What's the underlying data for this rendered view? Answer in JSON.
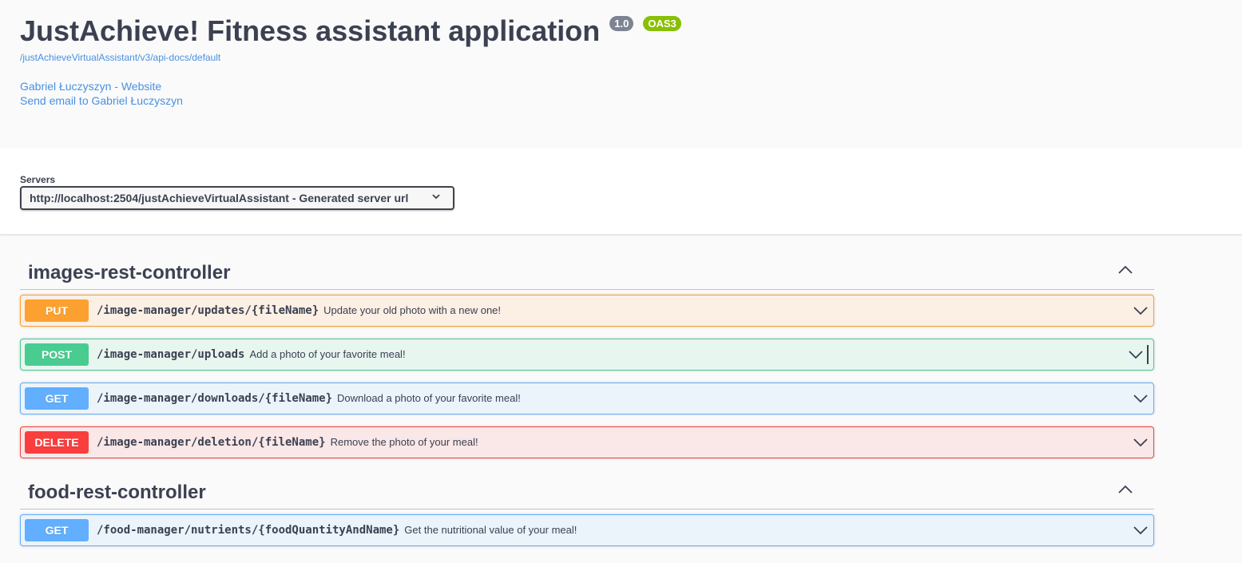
{
  "info": {
    "title": "JustAchieve! Fitness assistant application",
    "version": "1.0",
    "oas": "OAS3",
    "doc_url": "/justAchieveVirtualAssistant/v3/api-docs/default",
    "contact_website": "Gabriel Łuczyszyn - Website",
    "contact_email": "Send email to Gabriel Łuczyszyn"
  },
  "servers": {
    "label": "Servers",
    "selected": "http://localhost:2504/justAchieveVirtualAssistant - Generated server url"
  },
  "tags": [
    {
      "name": "images-rest-controller",
      "operations": [
        {
          "method": "PUT",
          "path": "/image-manager/updates/{fileName}",
          "summary": "Update your old photo with a new one!"
        },
        {
          "method": "POST",
          "path": "/image-manager/uploads",
          "summary": "Add a photo of your favorite meal!"
        },
        {
          "method": "GET",
          "path": "/image-manager/downloads/{fileName}",
          "summary": "Download a photo of your favorite meal!"
        },
        {
          "method": "DELETE",
          "path": "/image-manager/deletion/{fileName}",
          "summary": "Remove the photo of your meal!"
        }
      ]
    },
    {
      "name": "food-rest-controller",
      "operations": [
        {
          "method": "GET",
          "path": "/food-manager/nutrients/{foodQuantityAndName}",
          "summary": "Get the nutritional value of your meal!"
        }
      ]
    }
  ],
  "colors": {
    "put": "#fca130",
    "post": "#49cc90",
    "get": "#61affe",
    "delete": "#f93e3e",
    "link": "#4990e2",
    "version_badge": "#7d8492",
    "oas_badge": "#89bf04"
  }
}
